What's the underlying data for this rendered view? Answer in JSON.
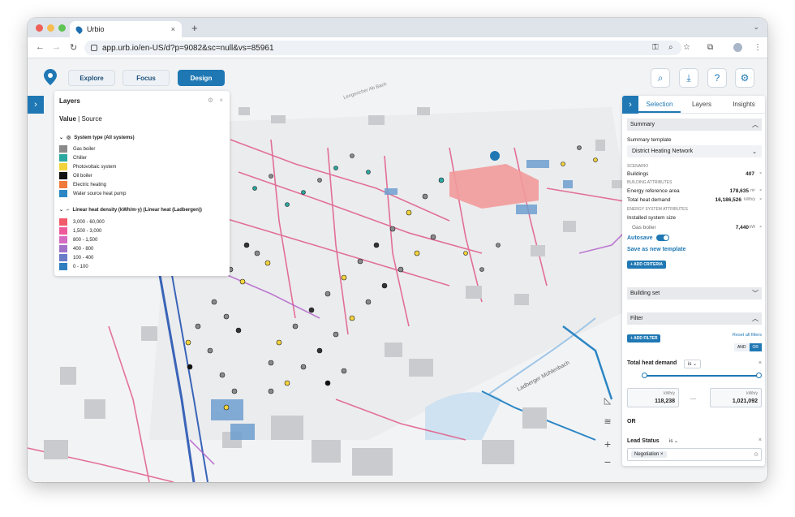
{
  "browser": {
    "tab_title": "Urbio",
    "tab_close": "×",
    "new_tab": "+",
    "url": "app.urb.io/en-US/d?p=9082&sc=null&vs=85961"
  },
  "app": {
    "nav": [
      "Explore",
      "Focus",
      "Design"
    ],
    "active_nav": "Design"
  },
  "layers_panel": {
    "title": "Layers",
    "value_label": "Value",
    "separator": "|",
    "source_label": "Source",
    "group1": "System type (All systems)",
    "systems": [
      {
        "label": "Gas boiler",
        "color": "#8a8a8a"
      },
      {
        "label": "Chiller",
        "color": "#2aa8a0"
      },
      {
        "label": "Photovoltaic system",
        "color": "#f2d33c"
      },
      {
        "label": "Oil boiler",
        "color": "#111111"
      },
      {
        "label": "Electric heating",
        "color": "#f07a3c"
      },
      {
        "label": "Water source heat pump",
        "color": "#2c86c4"
      }
    ],
    "group2": "Linear heat density (kWh/m·y) (Linear heat (Ladbergen))",
    "densities": [
      {
        "label": "3,000 - 60,000",
        "color": "#f05a6a"
      },
      {
        "label": "1,500 - 3,000",
        "color": "#ee5a9a"
      },
      {
        "label": "800 - 1,500",
        "color": "#d56cc0"
      },
      {
        "label": "400 - 800",
        "color": "#a272c8"
      },
      {
        "label": "100 - 400",
        "color": "#6a7cc8"
      },
      {
        "label": "0 - 100",
        "color": "#2f7fc0"
      }
    ]
  },
  "right_panel": {
    "tabs": [
      "Selection",
      "Layers",
      "Insights"
    ],
    "summary": "Summary",
    "summary_template_label": "Summary template",
    "summary_template_value": "District Heating Network",
    "scenario_label": "SCENARIO",
    "buildings_label": "Buildings",
    "buildings_value": "407",
    "building_attributes_label": "BUILDING ATTRIBUTES",
    "energy_ref_label": "Energy reference area",
    "energy_ref_value": "178,635",
    "energy_ref_unit": "m²",
    "heat_demand_label": "Total heat demand",
    "heat_demand_value": "16,186,526",
    "heat_demand_unit": "kWh/y",
    "energy_system_label": "ENERGY SYSTEM ATTRIBUTES",
    "installed_label": "Installed system size",
    "gas_boiler_label": "Gas boiler",
    "gas_boiler_value": "7,440",
    "gas_boiler_unit": "kW",
    "autosave": "Autosave",
    "save_template": "Save as new template",
    "add_criteria": "+ ADD CRITERIA",
    "building_set": "Building set",
    "filter": "Filter",
    "add_filter": "+ ADD FILTER",
    "reset_filters": "Reset all filters",
    "and_label": "AND",
    "or_label": "OR",
    "filter1_label": "Total heat demand",
    "filter1_op": "is",
    "min_unit": "kWh/y",
    "min_value": "118,238",
    "range_dash": "—",
    "max_unit": "kWh/y",
    "max_value": "1,021,092",
    "or_sep": "OR",
    "filter2_label": "Lead Status",
    "filter2_op": "is",
    "chip": "Negotiation"
  },
  "map": {
    "labels": [
      "Ladberger Mühlenbach",
      "Lengericher Ab Bach"
    ]
  }
}
